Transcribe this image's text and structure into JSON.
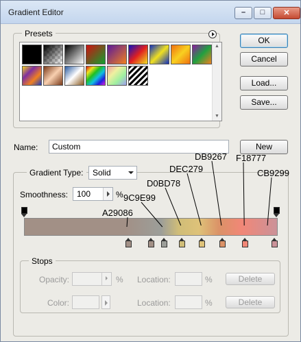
{
  "window": {
    "title": "Gradient Editor"
  },
  "titlebar": {
    "minimize_icon": "minimize-icon",
    "maximize_icon": "maximize-icon",
    "close_icon": "close-icon"
  },
  "presets": {
    "label": "Presets",
    "menu_icon": "flyout-menu-icon",
    "swatches": [
      {
        "name": "black-white",
        "colors": [
          "#000000",
          "#000000"
        ]
      },
      {
        "name": "transparent-checker",
        "colors": [
          "#808080",
          "#ffffff"
        ]
      },
      {
        "name": "black-to-white",
        "colors": [
          "#000000",
          "#ffffff"
        ]
      },
      {
        "name": "red-green",
        "colors": [
          "#d01010",
          "#10a030"
        ]
      },
      {
        "name": "violet-orange",
        "colors": [
          "#5a1a9a",
          "#f08020"
        ]
      },
      {
        "name": "blue-red-yellow",
        "colors": [
          "#1010c0",
          "#e02020",
          "#f0e020"
        ]
      },
      {
        "name": "blue-yellow-blue",
        "colors": [
          "#1030c0",
          "#f0e020",
          "#1030c0"
        ]
      },
      {
        "name": "orange-yellow-orange",
        "colors": [
          "#f07010",
          "#f8d020",
          "#f07010"
        ]
      },
      {
        "name": "violet-green-orange",
        "colors": [
          "#8a1aa0",
          "#20a040",
          "#f08020"
        ]
      },
      {
        "name": "yellow-violet-orange-blue",
        "colors": [
          "#f0d020",
          "#8030a0",
          "#f08020",
          "#2040c0"
        ]
      },
      {
        "name": "copper",
        "colors": [
          "#7a3a1a",
          "#f8d0b0",
          "#7a3a1a"
        ]
      },
      {
        "name": "chrome",
        "colors": [
          "#2a5aa0",
          "#ffffff",
          "#8a5a20"
        ]
      },
      {
        "name": "spectrum",
        "colors": [
          "#e01010",
          "#f0e020",
          "#20c020",
          "#10c0e0",
          "#2020e0",
          "#e020e0"
        ]
      },
      {
        "name": "transparent-rainbow",
        "colors": [
          "#f0a0a0",
          "#f0f0a0",
          "#a0f0a0",
          "#a0a0f0"
        ]
      },
      {
        "name": "transparent-stripes",
        "colors": [
          "#000000",
          "#ffffff"
        ]
      }
    ]
  },
  "buttons": {
    "ok": "OK",
    "cancel": "Cancel",
    "load": "Load...",
    "save": "Save...",
    "new": "New"
  },
  "name_field": {
    "label": "Name:",
    "value": "Custom"
  },
  "gradient_type": {
    "legend": "Gradient Type:",
    "value": "Solid"
  },
  "smoothness": {
    "label": "Smoothness:",
    "value": "100",
    "unit": "%"
  },
  "gradient": {
    "stops": [
      {
        "color": "#a29086",
        "location": 40
      },
      {
        "color": "#a29086",
        "location": 49
      },
      {
        "color": "#9c9e99",
        "location": 54
      },
      {
        "color": "#d0bd78",
        "location": 61
      },
      {
        "color": "#dec279",
        "location": 69
      },
      {
        "color": "#db9267",
        "location": 77
      },
      {
        "color": "#f18777",
        "location": 86
      },
      {
        "color": "#cb9299",
        "location": 100
      }
    ],
    "callouts": [
      "A29086",
      "9C9E99",
      "D0BD78",
      "DEC279",
      "DB9267",
      "F18777",
      "CB9299"
    ]
  },
  "stops_panel": {
    "legend": "Stops",
    "opacity_label": "Opacity:",
    "opacity_unit": "%",
    "color_label": "Color:",
    "location_label_1": "Location:",
    "location_label_2": "Location:",
    "location_unit_1": "%",
    "location_unit_2": "%",
    "delete_1": "Delete",
    "delete_2": "Delete"
  }
}
